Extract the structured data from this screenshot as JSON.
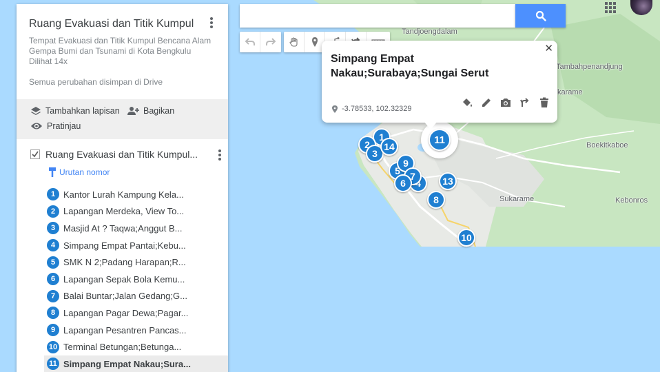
{
  "search": {
    "placeholder": "",
    "value": ""
  },
  "map": {
    "labels": [
      {
        "text": "Tandjoengdalam",
        "id": "tandjoengdalam"
      },
      {
        "text": "Tambahpenandjung",
        "id": "tambahpenandjung"
      },
      {
        "text": "karame",
        "id": "karame"
      },
      {
        "text": "Boekitkaboe",
        "id": "boekitkaboe"
      },
      {
        "text": "Sukarame",
        "id": "sukarame"
      },
      {
        "text": "Kebonros",
        "id": "kebonros"
      }
    ],
    "markers": [
      "1",
      "2",
      "3",
      "14",
      "5",
      "9",
      "7",
      "6",
      "4",
      "13",
      "8",
      "10",
      "11"
    ]
  },
  "popup": {
    "title": "Simpang Empat Nakau;Surabaya;Sungai Serut",
    "coords": "-3.78533, 102.32329",
    "close": "✕"
  },
  "panel": {
    "title": "Ruang Evakuasi dan Titik Kumpul",
    "description": "Tempat Evakuasi dan Titik Kumpul Bencana Alam Gempa Bumi dan Tsunami di Kota Bengkulu",
    "views": "Dilihat 14x",
    "saved": "Semua perubahan disimpan di Drive",
    "add_layer": "Tambahkan lapisan",
    "share": "Bagikan",
    "preview": "Pratinjau",
    "layer_title": "Ruang Evakuasi dan Titik Kumpul...",
    "style_link": "Urutan nomor",
    "items": [
      {
        "num": "1",
        "name": "Kantor Lurah Kampung Kela..."
      },
      {
        "num": "2",
        "name": "Lapangan Merdeka, View To..."
      },
      {
        "num": "3",
        "name": "Masjid At ? Taqwa;Anggut B..."
      },
      {
        "num": "4",
        "name": "Simpang Empat Pantai;Kebu..."
      },
      {
        "num": "5",
        "name": "SMK N 2;Padang Harapan;R..."
      },
      {
        "num": "6",
        "name": "Lapangan Sepak Bola Kemu..."
      },
      {
        "num": "7",
        "name": "Balai Buntar;Jalan Gedang;G..."
      },
      {
        "num": "8",
        "name": "Lapangan Pagar Dewa;Pagar..."
      },
      {
        "num": "9",
        "name": "Lapangan Pesantren Pancas..."
      },
      {
        "num": "10",
        "name": "Terminal Betungan;Betunga..."
      },
      {
        "num": "11",
        "name": "Simpang Empat Nakau;Sura..."
      }
    ]
  },
  "colors": {
    "marker": "#1f7fd1",
    "search_button": "#4d90fe",
    "link": "#4285f4",
    "water": "#aadaff",
    "land": "#e8eae6",
    "forest": "#c8e6c1"
  }
}
